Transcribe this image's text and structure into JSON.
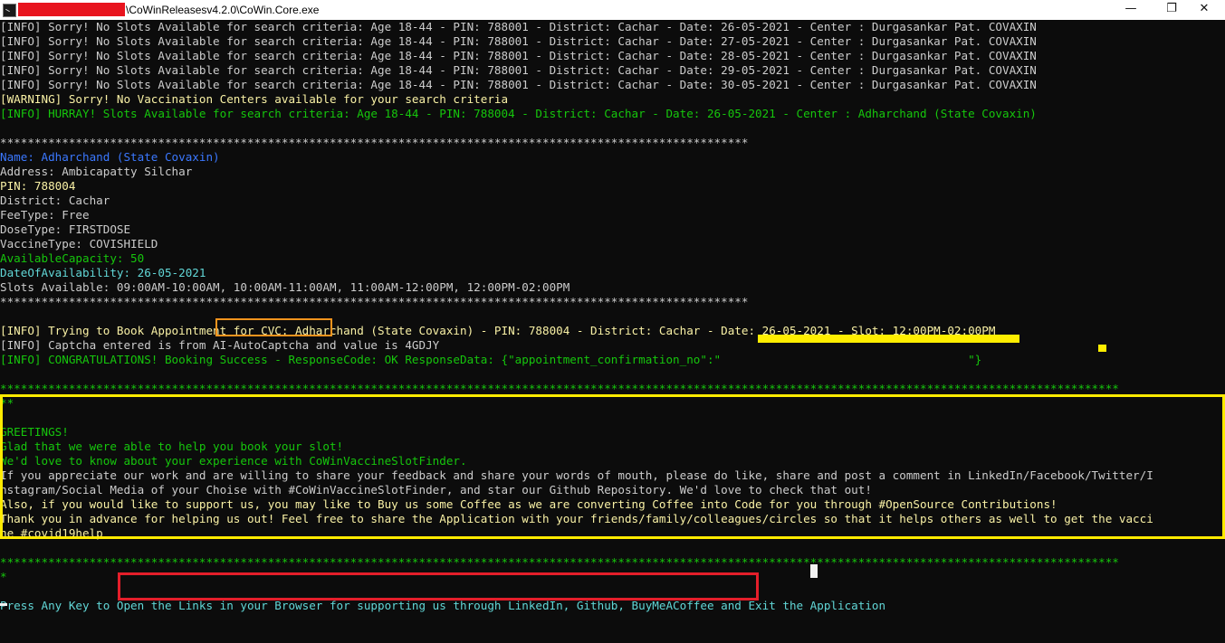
{
  "window": {
    "title": "\\CoWinReleasesv4.2.0\\CoWin.Core.exe",
    "minimize_glyph": "—",
    "maximize_glyph": "❐",
    "close_glyph": "✕"
  },
  "colors": {
    "background": "#0c0c0c",
    "info_gray": "#cccccc",
    "warning_yellow": "#f9f1a5",
    "success_green": "#16c60c",
    "name_blue": "#3b78ff",
    "prompt_cyan": "#61d6d6",
    "highlight_orange": "#f7941d",
    "highlight_yellow": "#ffeb00",
    "highlight_red": "#e41e2a"
  },
  "icons": {
    "app_icon": "console-app-icon"
  },
  "console": {
    "lines": [
      {
        "c": "gray",
        "t": "[INFO] Sorry! No Slots Available for search criteria: Age 18-44 - PIN: 788001 - District: Cachar - Date: 26-05-2021 - Center : Durgasankar Pat. COVAXIN"
      },
      {
        "c": "gray",
        "t": "[INFO] Sorry! No Slots Available for search criteria: Age 18-44 - PIN: 788001 - District: Cachar - Date: 27-05-2021 - Center : Durgasankar Pat. COVAXIN"
      },
      {
        "c": "gray",
        "t": "[INFO] Sorry! No Slots Available for search criteria: Age 18-44 - PIN: 788001 - District: Cachar - Date: 28-05-2021 - Center : Durgasankar Pat. COVAXIN"
      },
      {
        "c": "gray",
        "t": "[INFO] Sorry! No Slots Available for search criteria: Age 18-44 - PIN: 788001 - District: Cachar - Date: 29-05-2021 - Center : Durgasankar Pat. COVAXIN"
      },
      {
        "c": "gray",
        "t": "[INFO] Sorry! No Slots Available for search criteria: Age 18-44 - PIN: 788001 - District: Cachar - Date: 30-05-2021 - Center : Durgasankar Pat. COVAXIN"
      },
      {
        "c": "yel",
        "t": "[WARNING] Sorry! No Vaccination Centers available for your search criteria"
      },
      {
        "c": "grn",
        "t": "[INFO] HURRAY! Slots Available for search criteria: Age 18-44 - PIN: 788004 - District: Cachar - Date: 26-05-2021 - Center : Adharchand (State Covaxin)"
      },
      {
        "c": "gray",
        "t": ""
      },
      {
        "c": "gray",
        "t": "*************************************************************************************************************"
      },
      {
        "c": "blu",
        "t": "Name: Adharchand (State Covaxin)"
      },
      {
        "c": "gray",
        "t": "Address: Ambicapatty Silchar"
      },
      {
        "c": "yel",
        "t": "PIN: 788004"
      },
      {
        "c": "gray",
        "t": "District: Cachar"
      },
      {
        "c": "gray",
        "t": "FeeType: Free"
      },
      {
        "c": "gray",
        "t": "DoseType: FIRSTDOSE"
      },
      {
        "c": "gray",
        "t": "VaccineType: COVISHIELD"
      },
      {
        "c": "grn",
        "t": "AvailableCapacity: 50"
      },
      {
        "c": "cyn",
        "t": "DateOfAvailability: 26-05-2021"
      },
      {
        "c": "gray",
        "t": "Slots Available: 09:00AM-10:00AM, 10:00AM-11:00AM, 11:00AM-12:00PM, 12:00PM-02:00PM"
      },
      {
        "c": "gray",
        "t": "*************************************************************************************************************"
      },
      {
        "c": "gray",
        "t": ""
      },
      {
        "c": "yel",
        "t": "[INFO] Trying to Book Appointment for CVC: Adharchand (State Covaxin) - PIN: 788004 - District: Cachar - Date: 26-05-2021 - Slot: 12:00PM-02:00PM"
      },
      {
        "c": "gray",
        "t": "[INFO] Captcha entered is from AI-AutoCaptcha and value is 4GDJY"
      },
      {
        "c": "grn",
        "t": "[INFO] CONGRATULATIONS! Booking Success - ResponseCode: OK ResponseData: {\"appointment_confirmation_no\":\"                                    \"}"
      },
      {
        "c": "gray",
        "t": ""
      },
      {
        "c": "grn",
        "t": "*******************************************************************************************************************************************************************"
      },
      {
        "c": "grn",
        "t": "**"
      },
      {
        "c": "gray",
        "t": ""
      },
      {
        "c": "grn",
        "t": "GREETINGS!"
      },
      {
        "c": "grn",
        "t": "Glad that we were able to help you book your slot!"
      },
      {
        "c": "grn",
        "t": "We'd love to know about your experience with CoWinVaccineSlotFinder."
      },
      {
        "c": "gray",
        "t": "If you appreciate our work and are willing to share your feedback and share your words of mouth, please do like, share and post a comment in LinkedIn/Facebook/Twitter/I"
      },
      {
        "c": "gray",
        "t": "nstagram/Social Media of your Choise with #CoWinVaccineSlotFinder, and star our Github Repository. We'd love to check that out!"
      },
      {
        "c": "yel",
        "t": "Also, if you would like to support us, you may like to Buy us some Coffee as we are converting Coffee into Code for you through #OpenSource Contributions!"
      },
      {
        "c": "yel",
        "t": "Thank you in advance for helping us out! Feel free to share the Application with your friends/family/colleagues/circles so that it helps others as well to get the vacci"
      },
      {
        "c": "yel",
        "t": "ne #covid19help"
      },
      {
        "c": "gray",
        "t": ""
      },
      {
        "c": "grn",
        "t": "*******************************************************************************************************************************************************************"
      },
      {
        "c": "grn",
        "t": "*"
      },
      {
        "c": "gray",
        "t": ""
      },
      {
        "c": "cyn",
        "t": "Press Any Key to Open the Links in your Browser for supporting us through LinkedIn, Github, BuyMeACoffee and Exit the Application"
      }
    ]
  }
}
